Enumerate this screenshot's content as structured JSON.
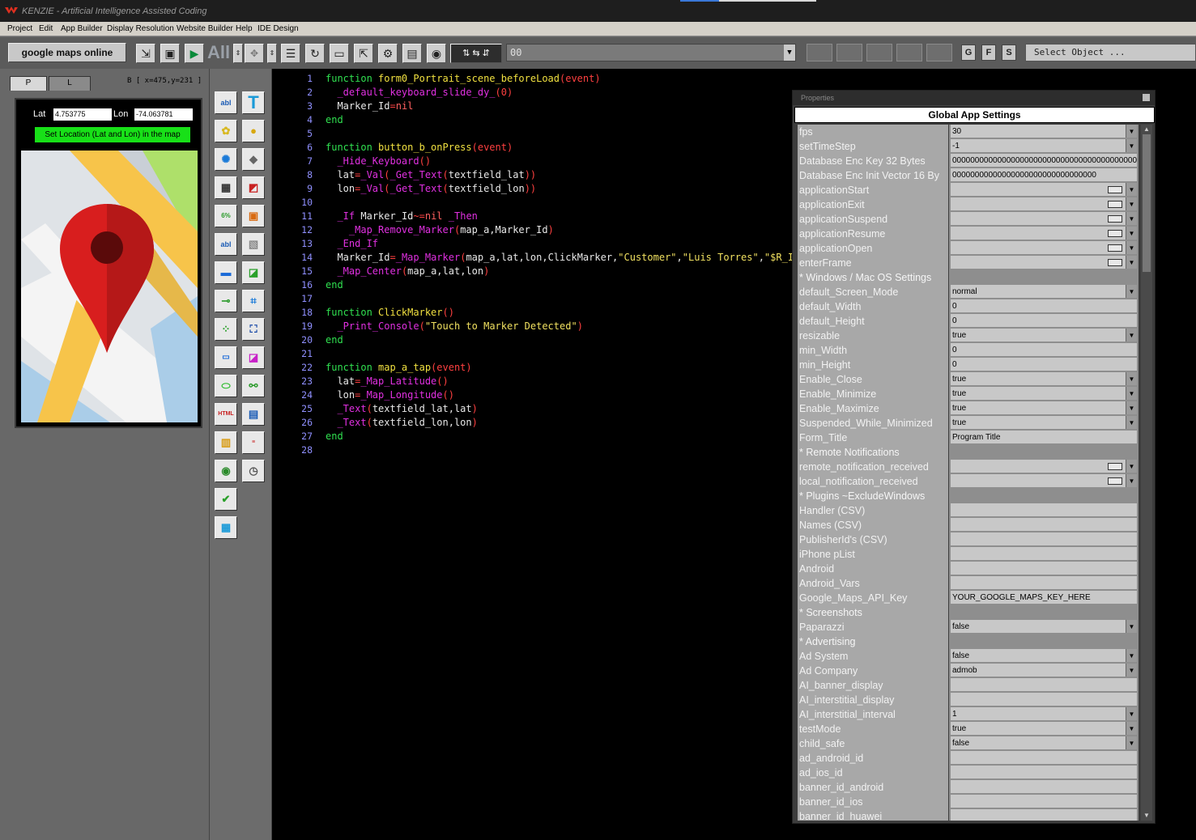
{
  "app": {
    "title": "KENZIE - Artificial Intelligence Assisted Coding"
  },
  "menu": [
    "Project",
    "Edit",
    "App Builder",
    "Display Resolution",
    "Website Builder",
    "Help",
    "IDE Design"
  ],
  "toolbar": {
    "project_name": "google maps online",
    "all_label": "All",
    "combo_value": "00",
    "gfs": [
      "G",
      "F",
      "S"
    ],
    "select_object": "Select Object ..."
  },
  "left": {
    "tab_portrait": "P",
    "tab_landscape": "L",
    "cursor_coords": "B [ x=475,y=231 ]",
    "phone": {
      "lat_label": "Lat",
      "lat_value": "4.753775",
      "lon_label": "Lon",
      "lon_value": "-74.063781",
      "set_button": "Set Location (Lat and Lon) in the map"
    }
  },
  "palette": {
    "items": [
      "textfield-icon",
      "text-icon",
      "image-icon",
      "sprite-icon",
      "animated-image-icon",
      "shape-icon",
      "table-icon",
      "collision-icon",
      "slider-icon",
      "object-icon",
      "textarea-icon",
      "selector-icon",
      "button-icon",
      "physics-icon",
      "slider-control-icon",
      "path-icon",
      "particles-icon",
      "camera-icon",
      "stepper-icon",
      "paint-icon",
      "switch-icon",
      "joint-icon",
      "html-icon",
      "web-icon",
      "widget-icon",
      "document-icon",
      "radio-icon",
      "timer-icon",
      "checkbox-icon",
      "video-icon"
    ]
  },
  "editor": {
    "lines": [
      [
        [
          "kw",
          "function "
        ],
        [
          "fn",
          "form0_Portrait_scene_beforeLoad"
        ],
        [
          "op",
          "(event)"
        ]
      ],
      [
        [
          "pl",
          "  "
        ],
        [
          "api",
          "_default_keyboard_slide_dy_"
        ],
        [
          "op",
          "(0)"
        ]
      ],
      [
        [
          "pl",
          "  Marker_Id"
        ],
        [
          "op",
          "="
        ],
        [
          "nil",
          "nil"
        ]
      ],
      [
        [
          "kw",
          "end"
        ]
      ],
      [],
      [
        [
          "kw",
          "function "
        ],
        [
          "fn",
          "button_b_onPress"
        ],
        [
          "op",
          "(event)"
        ]
      ],
      [
        [
          "pl",
          "  "
        ],
        [
          "api",
          "_Hide_Keyboard"
        ],
        [
          "op",
          "()"
        ]
      ],
      [
        [
          "pl",
          "  lat"
        ],
        [
          "op",
          "="
        ],
        [
          "api",
          "_Val"
        ],
        [
          "op",
          "("
        ],
        [
          "api",
          "_Get_Text"
        ],
        [
          "op",
          "("
        ],
        [
          "pl",
          "textfield_lat"
        ],
        [
          "op",
          "))"
        ]
      ],
      [
        [
          "pl",
          "  lon"
        ],
        [
          "op",
          "="
        ],
        [
          "api",
          "_Val"
        ],
        [
          "op",
          "("
        ],
        [
          "api",
          "_Get_Text"
        ],
        [
          "op",
          "("
        ],
        [
          "pl",
          "textfield_lon"
        ],
        [
          "op",
          "))"
        ]
      ],
      [],
      [
        [
          "pl",
          "  "
        ],
        [
          "api",
          "_If"
        ],
        [
          "pl",
          " Marker_Id"
        ],
        [
          "op",
          "~="
        ],
        [
          "nil",
          "nil"
        ],
        [
          "pl",
          " "
        ],
        [
          "api",
          "_Then"
        ]
      ],
      [
        [
          "pl",
          "    "
        ],
        [
          "api",
          "_Map_Remove_Marker"
        ],
        [
          "op",
          "("
        ],
        [
          "pl",
          "map_a,Marker_Id"
        ],
        [
          "op",
          ")"
        ]
      ],
      [
        [
          "pl",
          "  "
        ],
        [
          "api",
          "_End_If"
        ]
      ],
      [
        [
          "pl",
          "  Marker_Id"
        ],
        [
          "op",
          "="
        ],
        [
          "api",
          "_Map_Marker"
        ],
        [
          "op",
          "("
        ],
        [
          "pl",
          "map_a,lat,lon,ClickMarker,"
        ],
        [
          "str",
          "\"Customer\""
        ],
        [
          "pl",
          ","
        ],
        [
          "str",
          "\"Luis Torres\""
        ],
        [
          "pl",
          ","
        ],
        [
          "str",
          "\"$R_Ico"
        ]
      ],
      [
        [
          "pl",
          "  "
        ],
        [
          "api",
          "_Map_Center"
        ],
        [
          "op",
          "("
        ],
        [
          "pl",
          "map_a,lat,lon"
        ],
        [
          "op",
          ")"
        ]
      ],
      [
        [
          "kw",
          "end"
        ]
      ],
      [],
      [
        [
          "kw",
          "function "
        ],
        [
          "fn",
          "ClickMarker"
        ],
        [
          "op",
          "()"
        ]
      ],
      [
        [
          "pl",
          "  "
        ],
        [
          "api",
          "_Print_Console"
        ],
        [
          "op",
          "("
        ],
        [
          "str",
          "\"Touch to Marker Detected\""
        ],
        [
          "op",
          ")"
        ]
      ],
      [
        [
          "kw",
          "end"
        ]
      ],
      [],
      [
        [
          "kw",
          "function "
        ],
        [
          "fn",
          "map_a_tap"
        ],
        [
          "op",
          "(event)"
        ]
      ],
      [
        [
          "pl",
          "  lat"
        ],
        [
          "op",
          "="
        ],
        [
          "api",
          "_Map_Latitude"
        ],
        [
          "op",
          "()"
        ]
      ],
      [
        [
          "pl",
          "  lon"
        ],
        [
          "op",
          "="
        ],
        [
          "api",
          "_Map_Longitude"
        ],
        [
          "op",
          "()"
        ]
      ],
      [
        [
          "pl",
          "  "
        ],
        [
          "api",
          "_Text"
        ],
        [
          "op",
          "("
        ],
        [
          "pl",
          "textfield_lat,lat"
        ],
        [
          "op",
          ")"
        ]
      ],
      [
        [
          "pl",
          "  "
        ],
        [
          "api",
          "_Text"
        ],
        [
          "op",
          "("
        ],
        [
          "pl",
          "textfield_lon,lon"
        ],
        [
          "op",
          ")"
        ]
      ],
      [
        [
          "kw",
          "end"
        ]
      ],
      []
    ]
  },
  "properties": {
    "window_title": "Properties",
    "header": "Global App Settings",
    "rows": [
      {
        "name": "fps",
        "value": "30",
        "kind": "dropdown"
      },
      {
        "name": "setTimeStep",
        "value": "-1",
        "kind": "dropdown"
      },
      {
        "name": "Database Enc Key 32 Bytes",
        "value": "00000000000000000000000000000000000000000",
        "kind": "text"
      },
      {
        "name": "Database Enc Init Vector 16 By",
        "value": "00000000000000000000000000000000",
        "kind": "text"
      },
      {
        "name": "applicationStart",
        "value": "",
        "kind": "event"
      },
      {
        "name": "applicationExit",
        "value": "",
        "kind": "event"
      },
      {
        "name": "applicationSuspend",
        "value": "",
        "kind": "event"
      },
      {
        "name": "applicationResume",
        "value": "",
        "kind": "event"
      },
      {
        "name": "applicationOpen",
        "value": "",
        "kind": "event"
      },
      {
        "name": "enterFrame",
        "value": "",
        "kind": "event"
      },
      {
        "name": "* Windows / Mac OS Settings",
        "value": "",
        "kind": "section"
      },
      {
        "name": "default_Screen_Mode",
        "value": "normal",
        "kind": "dropdown"
      },
      {
        "name": "default_Width",
        "value": "0",
        "kind": "text"
      },
      {
        "name": "default_Height",
        "value": "0",
        "kind": "text"
      },
      {
        "name": "resizable",
        "value": "true",
        "kind": "dropdown"
      },
      {
        "name": "min_Width",
        "value": "0",
        "kind": "text"
      },
      {
        "name": "min_Height",
        "value": "0",
        "kind": "text"
      },
      {
        "name": "Enable_Close",
        "value": "true",
        "kind": "dropdown"
      },
      {
        "name": "Enable_Minimize",
        "value": "true",
        "kind": "dropdown"
      },
      {
        "name": "Enable_Maximize",
        "value": "true",
        "kind": "dropdown"
      },
      {
        "name": "Suspended_While_Minimized",
        "value": "true",
        "kind": "dropdown"
      },
      {
        "name": "Form_Title",
        "value": "Program Title",
        "kind": "text"
      },
      {
        "name": "* Remote Notifications",
        "value": "",
        "kind": "section"
      },
      {
        "name": "remote_notification_received",
        "value": "",
        "kind": "event"
      },
      {
        "name": "local_notification_received",
        "value": "",
        "kind": "event"
      },
      {
        "name": "* Plugins ~ExcludeWindows",
        "value": "",
        "kind": "section"
      },
      {
        "name": "Handler (CSV)",
        "value": "",
        "kind": "text"
      },
      {
        "name": "Names (CSV)",
        "value": "",
        "kind": "text"
      },
      {
        "name": "PublisherId's (CSV)",
        "value": "",
        "kind": "text"
      },
      {
        "name": "iPhone pList",
        "value": "",
        "kind": "text"
      },
      {
        "name": "Android",
        "value": "",
        "kind": "text"
      },
      {
        "name": "Android_Vars",
        "value": "",
        "kind": "text"
      },
      {
        "name": "Google_Maps_API_Key",
        "value": "YOUR_GOOGLE_MAPS_KEY_HERE",
        "kind": "text"
      },
      {
        "name": "* Screenshots",
        "value": "",
        "kind": "section"
      },
      {
        "name": "Paparazzi",
        "value": "false",
        "kind": "dropdown"
      },
      {
        "name": "* Advertising",
        "value": "",
        "kind": "section"
      },
      {
        "name": "Ad System",
        "value": "false",
        "kind": "dropdown"
      },
      {
        "name": "Ad Company",
        "value": "admob",
        "kind": "dropdown"
      },
      {
        "name": "AI_banner_display",
        "value": "",
        "kind": "text"
      },
      {
        "name": "AI_interstitial_display",
        "value": "",
        "kind": "text"
      },
      {
        "name": "AI_interstitial_interval",
        "value": "1",
        "kind": "dropdown"
      },
      {
        "name": "testMode",
        "value": "true",
        "kind": "dropdown"
      },
      {
        "name": "child_safe",
        "value": "false",
        "kind": "dropdown"
      },
      {
        "name": "ad_android_id",
        "value": "",
        "kind": "text"
      },
      {
        "name": "ad_ios_id",
        "value": "",
        "kind": "text"
      },
      {
        "name": "banner_id_android",
        "value": "",
        "kind": "text"
      },
      {
        "name": "banner_id_ios",
        "value": "",
        "kind": "text"
      },
      {
        "name": "banner_id_huawei",
        "value": "",
        "kind": "text"
      }
    ]
  }
}
